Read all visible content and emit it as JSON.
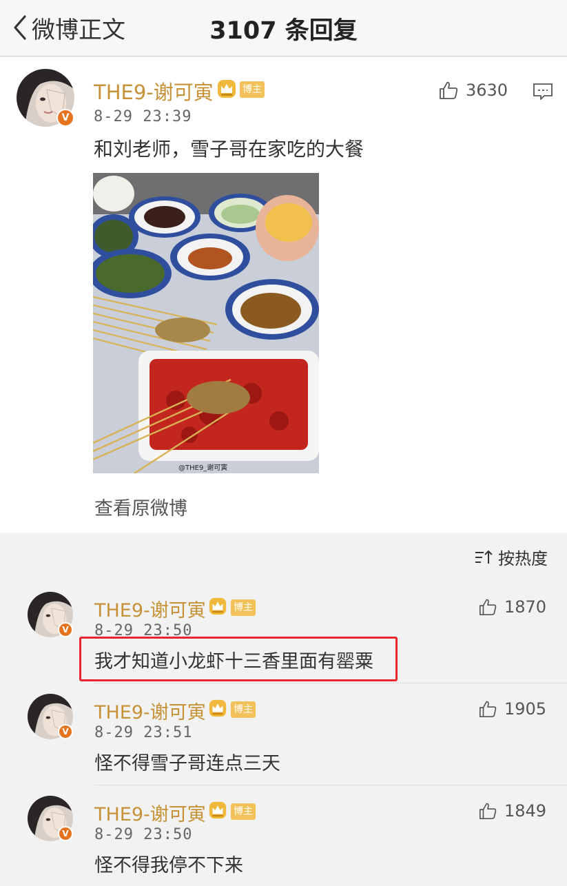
{
  "nav": {
    "back_label": "微博正文",
    "title": "3107 条回复"
  },
  "post": {
    "username": "THE9-谢可寅",
    "badge": "博主",
    "timestamp": "8-29 23:39",
    "text": "和刘老师，雪子哥在家吃的大餐",
    "likes": "3630",
    "image_watermark": "@THE9_谢可寅",
    "view_original": "查看原微博"
  },
  "sort": {
    "label": "按热度"
  },
  "comments": [
    {
      "username": "THE9-谢可寅",
      "badge": "博主",
      "timestamp": "8-29 23:50",
      "text": "我才知道小龙虾十三香里面有罂粟",
      "likes": "1870",
      "highlighted": true
    },
    {
      "username": "THE9-谢可寅",
      "badge": "博主",
      "timestamp": "8-29 23:51",
      "text": "怪不得雪子哥连点三天",
      "likes": "1905"
    },
    {
      "username": "THE9-谢可寅",
      "badge": "博主",
      "timestamp": "8-29 23:50",
      "text": "怪不得我停不下来",
      "likes": "1849"
    }
  ],
  "colors": {
    "username": "#c69137",
    "badge": "#f3c15a",
    "highlight": "#e8242c",
    "verified": "#e6731e"
  },
  "icons": {
    "back": "chevron-left-icon",
    "like": "thumbs-up-icon",
    "comment": "comment-icon",
    "sort": "sort-icon",
    "crown": "crown-icon",
    "verified": "verified-v-icon"
  }
}
